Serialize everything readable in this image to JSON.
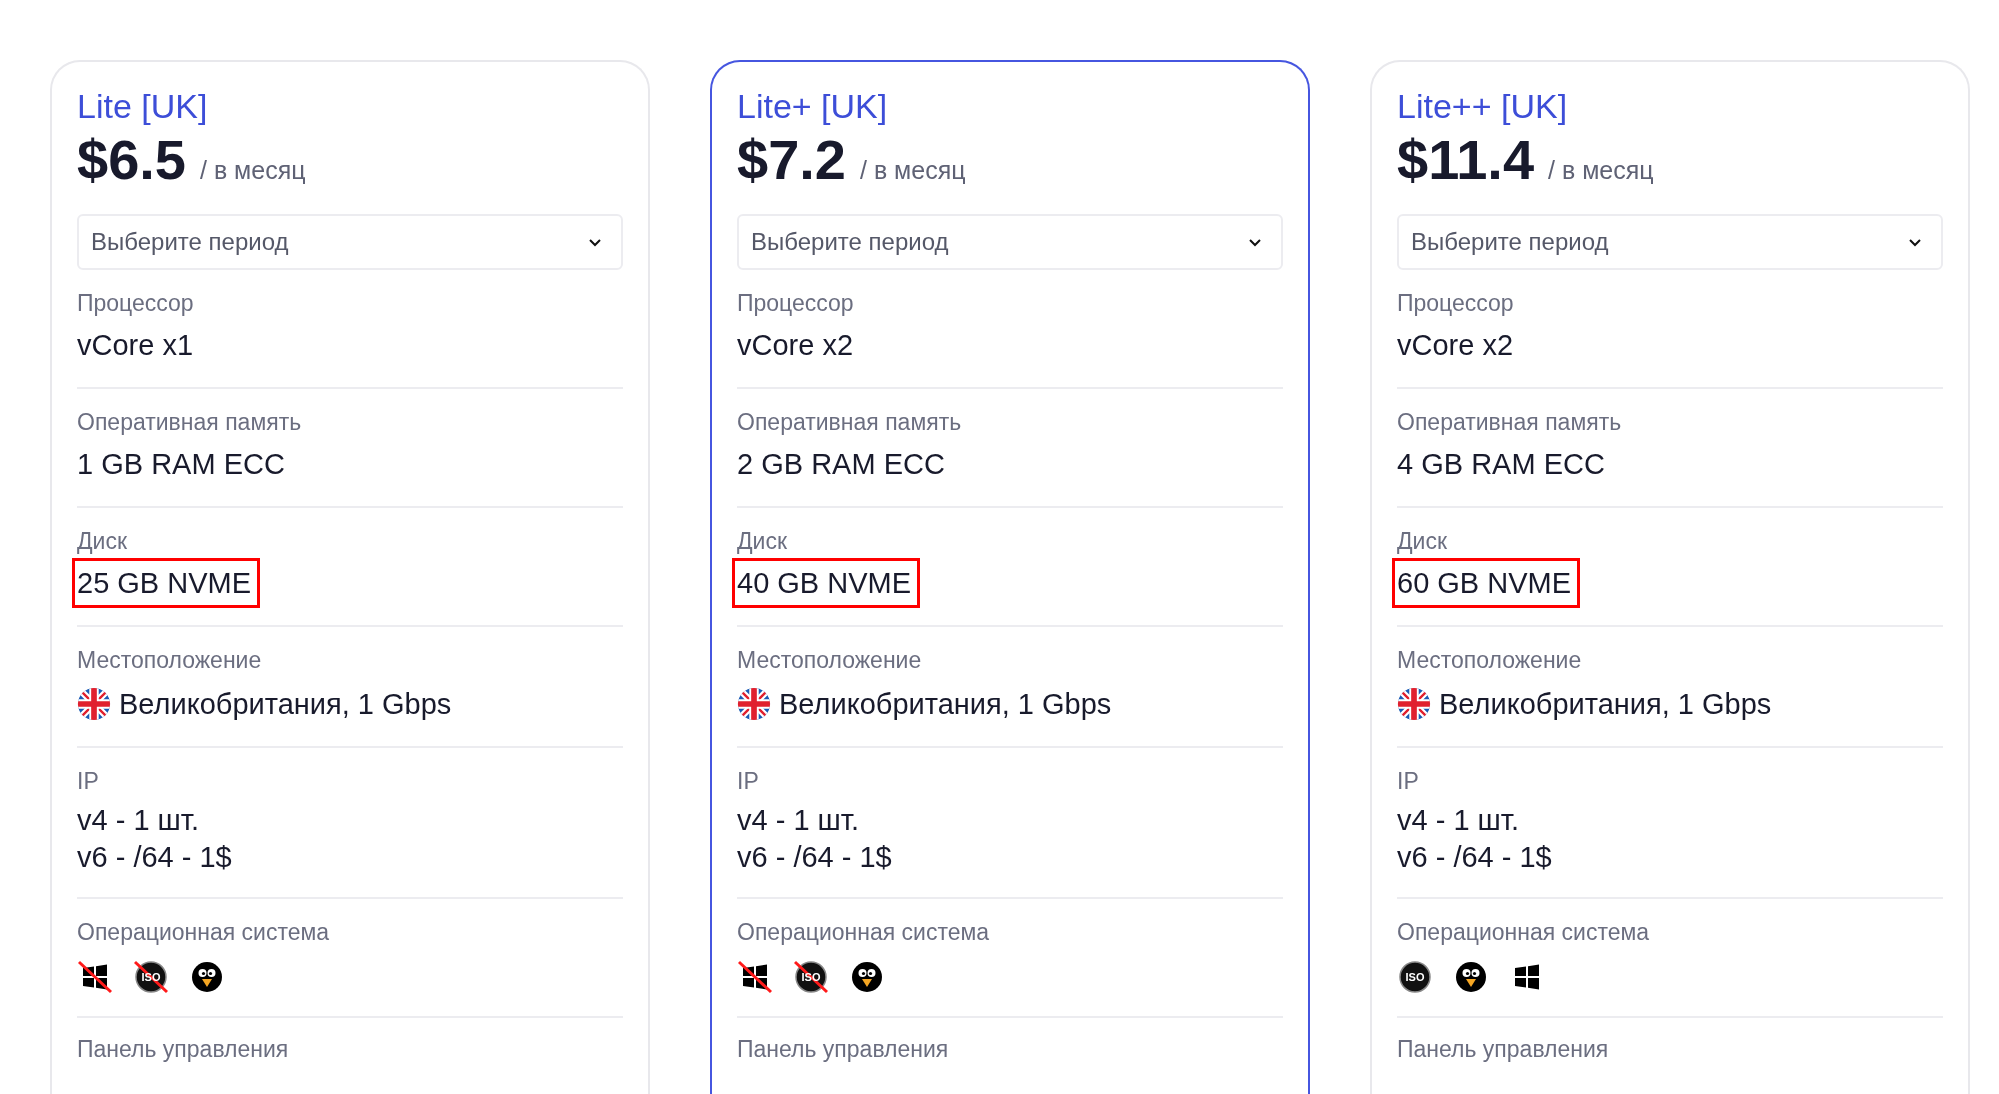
{
  "plans": [
    {
      "name": "Lite [UK]",
      "price": "$6.5",
      "period": "/ в месяц",
      "selected": false,
      "period_select": {
        "placeholder": "Выберите период"
      },
      "specs": [
        {
          "kind": "text",
          "label": "Процессор",
          "value": "vCore x1",
          "highlighted": false
        },
        {
          "kind": "text",
          "label": "Оперативная память",
          "value": "1 GB RAM ECC",
          "highlighted": false
        },
        {
          "kind": "text",
          "label": "Диск",
          "value": "25 GB NVME",
          "highlighted": true
        },
        {
          "kind": "location",
          "label": "Местоположение",
          "value": "Великобритания, 1 Gbps"
        },
        {
          "kind": "lines",
          "label": "IP",
          "lines": [
            "v4 - 1 шт.",
            "v6 - /64 - 1$"
          ]
        },
        {
          "kind": "os",
          "label": "Операционная система",
          "systems": [
            {
              "kind": "windows",
              "disabled": true
            },
            {
              "kind": "iso",
              "text": "ISO",
              "disabled": true
            },
            {
              "kind": "linux",
              "disabled": false
            }
          ]
        },
        {
          "kind": "heading",
          "label": "Панель управления"
        }
      ]
    },
    {
      "name": "Lite+ [UK]",
      "price": "$7.2",
      "period": "/ в месяц",
      "selected": true,
      "period_select": {
        "placeholder": "Выберите период"
      },
      "specs": [
        {
          "kind": "text",
          "label": "Процессор",
          "value": "vCore x2",
          "highlighted": false
        },
        {
          "kind": "text",
          "label": "Оперативная память",
          "value": "2 GB RAM ECC",
          "highlighted": false
        },
        {
          "kind": "text",
          "label": "Диск",
          "value": "40 GB NVME",
          "highlighted": true
        },
        {
          "kind": "location",
          "label": "Местоположение",
          "value": "Великобритания, 1 Gbps"
        },
        {
          "kind": "lines",
          "label": "IP",
          "lines": [
            "v4 - 1 шт.",
            "v6 - /64 - 1$"
          ]
        },
        {
          "kind": "os",
          "label": "Операционная система",
          "systems": [
            {
              "kind": "windows",
              "disabled": true
            },
            {
              "kind": "iso",
              "text": "ISO",
              "disabled": true
            },
            {
              "kind": "linux",
              "disabled": false
            }
          ]
        },
        {
          "kind": "heading",
          "label": "Панель управления"
        }
      ]
    },
    {
      "name": "Lite++ [UK]",
      "price": "$11.4",
      "period": "/ в месяц",
      "selected": false,
      "period_select": {
        "placeholder": "Выберите период"
      },
      "specs": [
        {
          "kind": "text",
          "label": "Процессор",
          "value": "vCore x2",
          "highlighted": false
        },
        {
          "kind": "text",
          "label": "Оперативная память",
          "value": "4 GB RAM ECC",
          "highlighted": false
        },
        {
          "kind": "text",
          "label": "Диск",
          "value": "60 GB NVME",
          "highlighted": true
        },
        {
          "kind": "location",
          "label": "Местоположение",
          "value": "Великобритания, 1 Gbps"
        },
        {
          "kind": "lines",
          "label": "IP",
          "lines": [
            "v4 - 1 шт.",
            "v6 - /64 - 1$"
          ]
        },
        {
          "kind": "os",
          "label": "Операционная система",
          "systems": [
            {
              "kind": "iso",
              "text": "ISO",
              "disabled": false
            },
            {
              "kind": "linux",
              "disabled": false
            },
            {
              "kind": "windows",
              "disabled": false
            }
          ]
        },
        {
          "kind": "heading",
          "label": "Панель управления"
        }
      ]
    }
  ]
}
